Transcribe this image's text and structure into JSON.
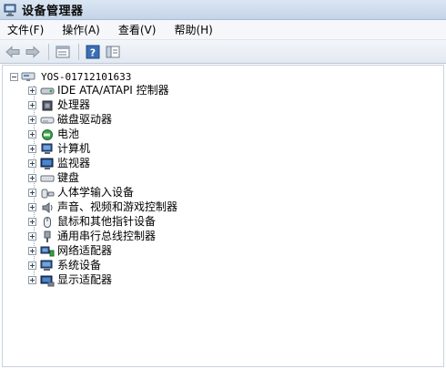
{
  "window": {
    "title": "设备管理器"
  },
  "menu": [
    {
      "label": "文件(F)"
    },
    {
      "label": "操作(A)"
    },
    {
      "label": "查看(V)"
    },
    {
      "label": "帮助(H)"
    }
  ],
  "toolbar": {
    "icons": [
      "back-arrow-icon",
      "forward-arrow-icon",
      "properties-icon",
      "help-icon",
      "show-hide-pane-icon"
    ]
  },
  "tree": {
    "root": "YOS-01712101633",
    "items": [
      {
        "label": "IDE ATA/ATAPI 控制器",
        "icon": "ide-controller-icon"
      },
      {
        "label": "处理器",
        "icon": "processor-icon"
      },
      {
        "label": "磁盘驱动器",
        "icon": "disk-drive-icon"
      },
      {
        "label": "电池",
        "icon": "battery-icon"
      },
      {
        "label": "计算机",
        "icon": "computer-icon"
      },
      {
        "label": "监视器",
        "icon": "monitor-icon"
      },
      {
        "label": "键盘",
        "icon": "keyboard-icon"
      },
      {
        "label": "人体学输入设备",
        "icon": "hid-icon"
      },
      {
        "label": "声音、视频和游戏控制器",
        "icon": "sound-icon"
      },
      {
        "label": "鼠标和其他指针设备",
        "icon": "mouse-icon"
      },
      {
        "label": "通用串行总线控制器",
        "icon": "usb-icon"
      },
      {
        "label": "网络适配器",
        "icon": "network-icon"
      },
      {
        "label": "系统设备",
        "icon": "system-device-icon"
      },
      {
        "label": "显示适配器",
        "icon": "display-adapter-icon"
      }
    ]
  }
}
